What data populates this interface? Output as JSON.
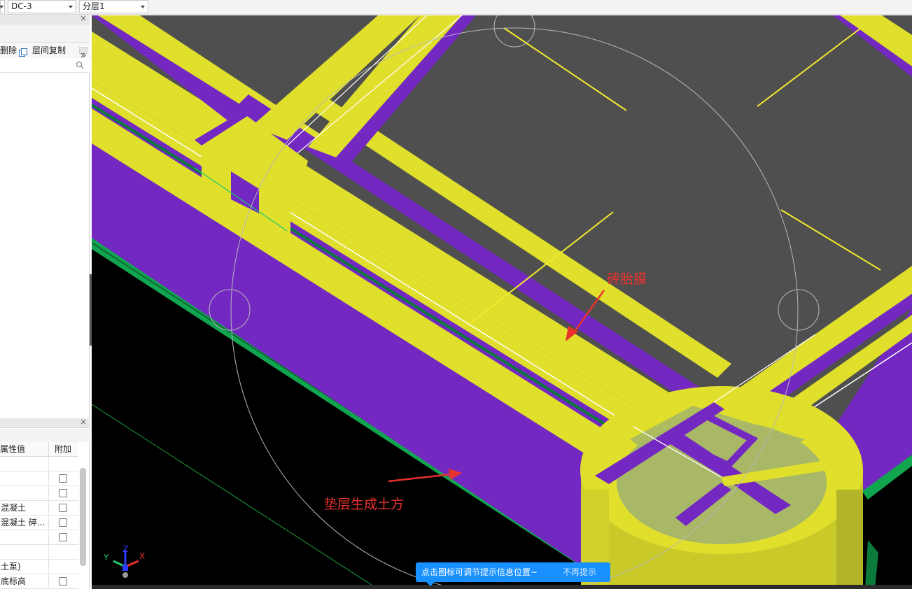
{
  "toolbar": {
    "combo_component": "DC-3",
    "combo_layer": "分层1"
  },
  "left_panel": {
    "delete_label": "删除",
    "copy_label": "层间复制",
    "property_header_value": "属性值",
    "property_header_extra": "附加",
    "properties": [
      {
        "value": ""
      },
      {
        "value": ""
      },
      {
        "value": ""
      },
      {
        "value": "混凝土"
      },
      {
        "value": "混凝土 碎..."
      },
      {
        "value": ""
      },
      {
        "value": ""
      },
      {
        "value": "土泵)"
      },
      {
        "value": "底标高"
      }
    ]
  },
  "viewport": {
    "annotation_top": "砖胎膜",
    "annotation_bottom": "垫层生成土方",
    "axis_x": "X",
    "axis_y": "Y",
    "axis_z": "Z"
  },
  "tip": {
    "message": "点击图标可调节提示信息位置~",
    "dismiss": "不再提示"
  },
  "colors": {
    "yellow": "#e0df2c",
    "purple": "#7428c2",
    "dark_gray": "#4f4f4f",
    "green": "#11a550",
    "annotation_red": "#e8322e",
    "tip_blue": "#1890ff"
  }
}
